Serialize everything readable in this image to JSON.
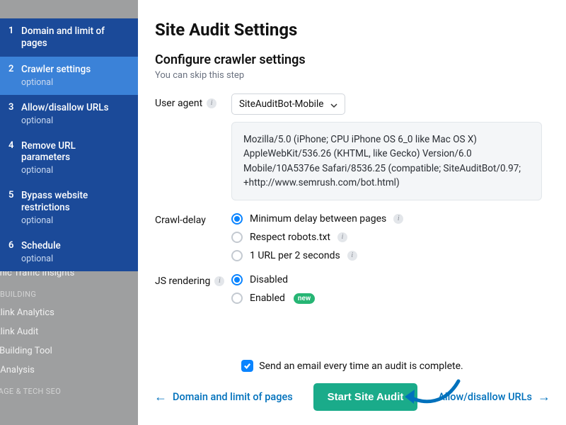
{
  "main": {
    "title": "Site Audit Settings",
    "subtitle": "Configure crawler settings",
    "skip_note": "You can skip this step",
    "user_agent_label": "User agent",
    "user_agent_selected": "SiteAuditBot-Mobile",
    "user_agent_string": "Mozilla/5.0 (iPhone; CPU iPhone OS 6_0 like Mac OS X) AppleWebKit/536.26 (KHTML, like Gecko) Version/6.0 Mobile/10A5376e Safari/8536.25 (compatible; SiteAuditBot/0.97; +http://www.semrush.com/bot.html)",
    "crawl_delay_label": "Crawl-delay",
    "crawl_delay_options": [
      "Minimum delay between pages",
      "Respect robots.txt",
      "1 URL per 2 seconds"
    ],
    "js_rendering_label": "JS rendering",
    "js_rendering_options": [
      "Disabled",
      "Enabled"
    ],
    "new_badge": "new",
    "email_checkbox_label": "Send an email every time an audit is complete.",
    "prev_label": "Domain and limit of pages",
    "next_label": "Allow/disallow URLs",
    "cta_label": "Start Site Audit"
  },
  "steps": [
    {
      "num": "1",
      "label": "Domain and limit of pages",
      "optional": ""
    },
    {
      "num": "2",
      "label": "Crawler settings",
      "optional": "optional"
    },
    {
      "num": "3",
      "label": "Allow/disallow URLs",
      "optional": "optional"
    },
    {
      "num": "4",
      "label": "Remove URL parameters",
      "optional": "optional"
    },
    {
      "num": "5",
      "label": "Bypass website restrictions",
      "optional": "optional"
    },
    {
      "num": "6",
      "label": "Schedule",
      "optional": "optional"
    }
  ],
  "bgnav": {
    "item1": "Organic Traffic Insights",
    "header1": "LINK BUILDING",
    "item2": "Backlink Analytics",
    "item3": "Backlink Audit",
    "item4": "Link Building Tool",
    "item5": "Bulk Analysis",
    "header2": "ON PAGE & TECH SEO"
  },
  "info_glyph": "i"
}
